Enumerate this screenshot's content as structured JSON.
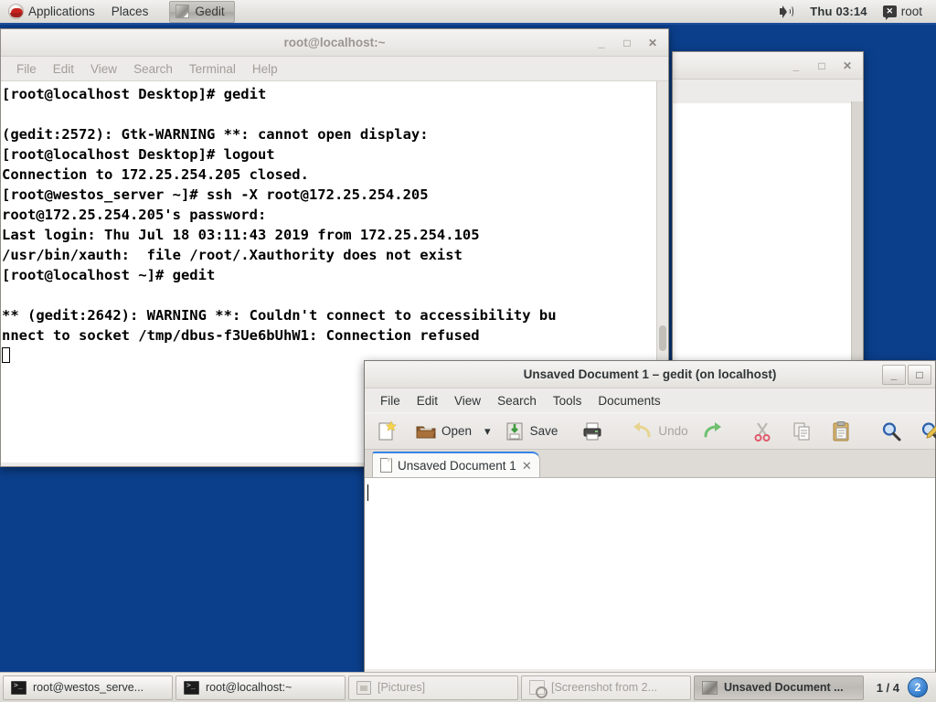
{
  "top_panel": {
    "applications_label": "Applications",
    "places_label": "Places",
    "window_button_label": "Gedit",
    "clock": "Thu 03:14",
    "user_label": "root",
    "icons": {
      "menu": "redhat-logo-icon",
      "volume": "speaker-icon",
      "user": "user-chat-icon"
    }
  },
  "terminal_window": {
    "title": "root@localhost:~",
    "menu": [
      "File",
      "Edit",
      "View",
      "Search",
      "Terminal",
      "Help"
    ],
    "buttons": {
      "minimize": "_",
      "maximize": "□",
      "close": "✕"
    },
    "content": "[root@localhost Desktop]# gedit\n\n(gedit:2572): Gtk-WARNING **: cannot open display:\n[root@localhost Desktop]# logout\nConnection to 172.25.254.205 closed.\n[root@westos_server ~]# ssh -X root@172.25.254.205\nroot@172.25.254.205's password:\nLast login: Thu Jul 18 03:11:43 2019 from 172.25.254.105\n/usr/bin/xauth:  file /root/.Xauthority does not exist\n[root@localhost ~]# gedit\n\n** (gedit:2642): WARNING **: Couldn't connect to accessibility bu\nnnect to socket /tmp/dbus-f3Ue6bUhW1: Connection refused"
  },
  "background_window": {
    "buttons": {
      "minimize": "_",
      "maximize": "□",
      "close": "✕"
    }
  },
  "gedit_window": {
    "title": "Unsaved Document 1 – gedit (on localhost)",
    "menu": [
      "File",
      "Edit",
      "View",
      "Search",
      "Tools",
      "Documents"
    ],
    "buttons": {
      "minimize": "_",
      "maximize": "□"
    },
    "toolbar": {
      "new_label": "",
      "open_label": "Open",
      "open_dropdown": "▾",
      "save_label": "Save",
      "print_label": "",
      "undo_label": "Undo",
      "redo_label": "",
      "cut_label": "",
      "copy_label": "",
      "paste_label": "",
      "find_label": "",
      "replace_label": ""
    },
    "tab": {
      "label": "Unsaved Document 1",
      "close": "✕"
    },
    "editor_text": ""
  },
  "taskbar": {
    "items": [
      {
        "label": "root@westos_serve...",
        "icon": "terminal-icon",
        "state": "normal"
      },
      {
        "label": "root@localhost:~",
        "icon": "terminal-icon",
        "state": "normal"
      },
      {
        "label": "[Pictures]",
        "icon": "folder-icon",
        "state": "minimized"
      },
      {
        "label": "[Screenshot from 2...",
        "icon": "screenshot-icon",
        "state": "minimized"
      },
      {
        "label": "Unsaved Document ...",
        "icon": "gedit-icon",
        "state": "active"
      }
    ],
    "workspace_label": "1 / 4",
    "workspace_badge": "2"
  },
  "colors": {
    "desktop": "#0b3f8c",
    "panel": "#e6e4e1",
    "panel_accent": "#1b4f9c",
    "tab_accent": "#3584e4"
  }
}
